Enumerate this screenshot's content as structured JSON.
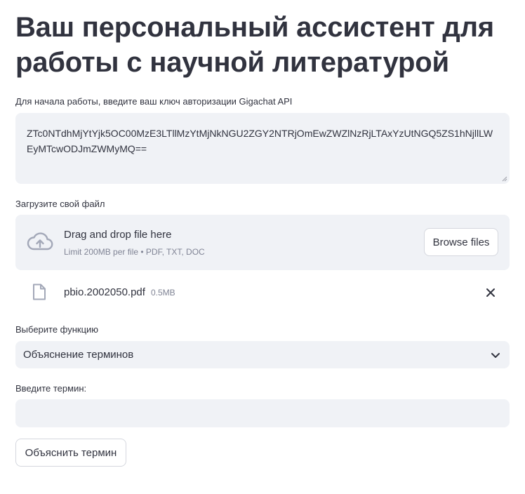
{
  "header": {
    "title": "Ваш персональный ассистент для работы с научной литературой"
  },
  "api_key": {
    "label": "Для начала работы, введите ваш ключ авторизации Gigachat API",
    "value": "ZTc0NTdhMjYtYjk5OC00MzE3LTllMzYtMjNkNGU2ZGY2NTRjOmEwZWZlNzRjLTAxYzUtNGQ5ZS1hNjllLWEyMTcwODJmZWMyMQ=="
  },
  "upload": {
    "label": "Загрузите свой файл",
    "dropzone_title": "Drag and drop file here",
    "dropzone_hint": "Limit 200MB per file • PDF, TXT, DOC",
    "browse_label": "Browse files",
    "file": {
      "name": "pbio.2002050.pdf",
      "size": "0.5MB"
    }
  },
  "function_select": {
    "label": "Выберите функцию",
    "selected": "Объяснение терминов"
  },
  "term_input": {
    "label": "Введите термин:",
    "value": ""
  },
  "action": {
    "button_label": "Объяснить термин"
  },
  "icons": {
    "upload": "cloud-upload-icon",
    "file": "file-icon",
    "remove": "close-icon",
    "dropdown": "chevron-down-icon"
  },
  "colors": {
    "text": "#31333f",
    "muted": "#808495",
    "field_background": "#f0f2f6",
    "icon": "#a3a8b8"
  }
}
